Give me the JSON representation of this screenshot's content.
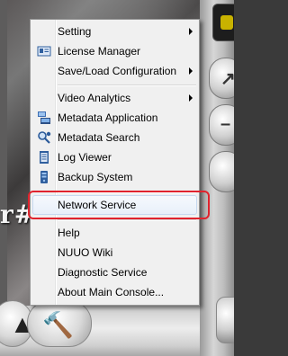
{
  "background": {
    "overlay_text": "r#"
  },
  "menu": {
    "items": [
      {
        "label": "Setting",
        "submenu": true
      },
      {
        "label": "License Manager",
        "icon": "license-icon"
      },
      {
        "label": "Save/Load Configuration",
        "submenu": true
      },
      {
        "label": "Video Analytics",
        "submenu": true
      },
      {
        "label": "Metadata Application",
        "icon": "metadata-application-icon"
      },
      {
        "label": "Metadata Search",
        "icon": "metadata-search-icon"
      },
      {
        "label": "Log Viewer",
        "icon": "log-viewer-icon"
      },
      {
        "label": "Backup System",
        "icon": "backup-system-icon"
      },
      {
        "label": "Network Service",
        "state": "hovered"
      },
      {
        "label": "Help"
      },
      {
        "label": "NUUO Wiki"
      },
      {
        "label": "Diagnostic Service"
      },
      {
        "label": "About Main Console..."
      }
    ]
  },
  "colors": {
    "annotation_box": "#e0232d",
    "hover": "#e8f0fa"
  }
}
